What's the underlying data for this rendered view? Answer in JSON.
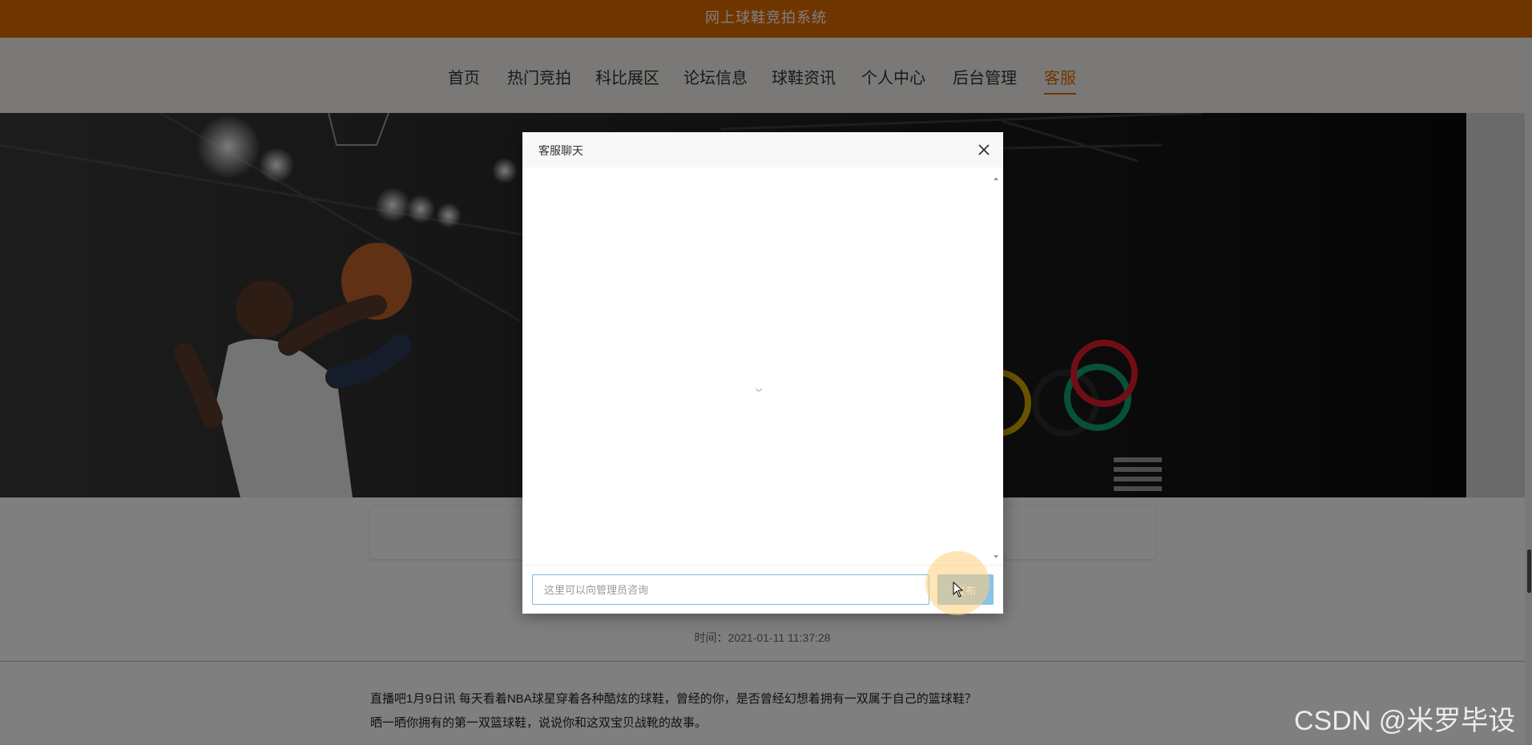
{
  "header": {
    "title": "网上球鞋竞拍系统"
  },
  "nav": {
    "items": [
      {
        "label": "首页"
      },
      {
        "label": "热门竞拍"
      },
      {
        "label": "科比展区"
      },
      {
        "label": "论坛信息"
      },
      {
        "label": "球鞋资讯"
      },
      {
        "label": "个人中心"
      },
      {
        "label": "后台管理"
      },
      {
        "label": "客服"
      }
    ],
    "active": "客服"
  },
  "article": {
    "time": "时间：2021-01-11 11:37:28",
    "paragraph1": "直播吧1月9日讯 每天看着NBA球星穿着各种酷炫的球鞋，曾经的你，是否曾经幻想着拥有一双属于自己的篮球鞋？",
    "paragraph2": "晒一晒你拥有的第一双篮球鞋，说说你和这双宝贝战靴的故事。"
  },
  "dialog": {
    "title": "客服聊天",
    "input_placeholder": "这里可以向管理员咨询",
    "send_label": "发布"
  },
  "watermark": "CSDN @米罗毕设",
  "colors": {
    "accent": "#e06c00",
    "send_button": "#8cc1e8"
  }
}
